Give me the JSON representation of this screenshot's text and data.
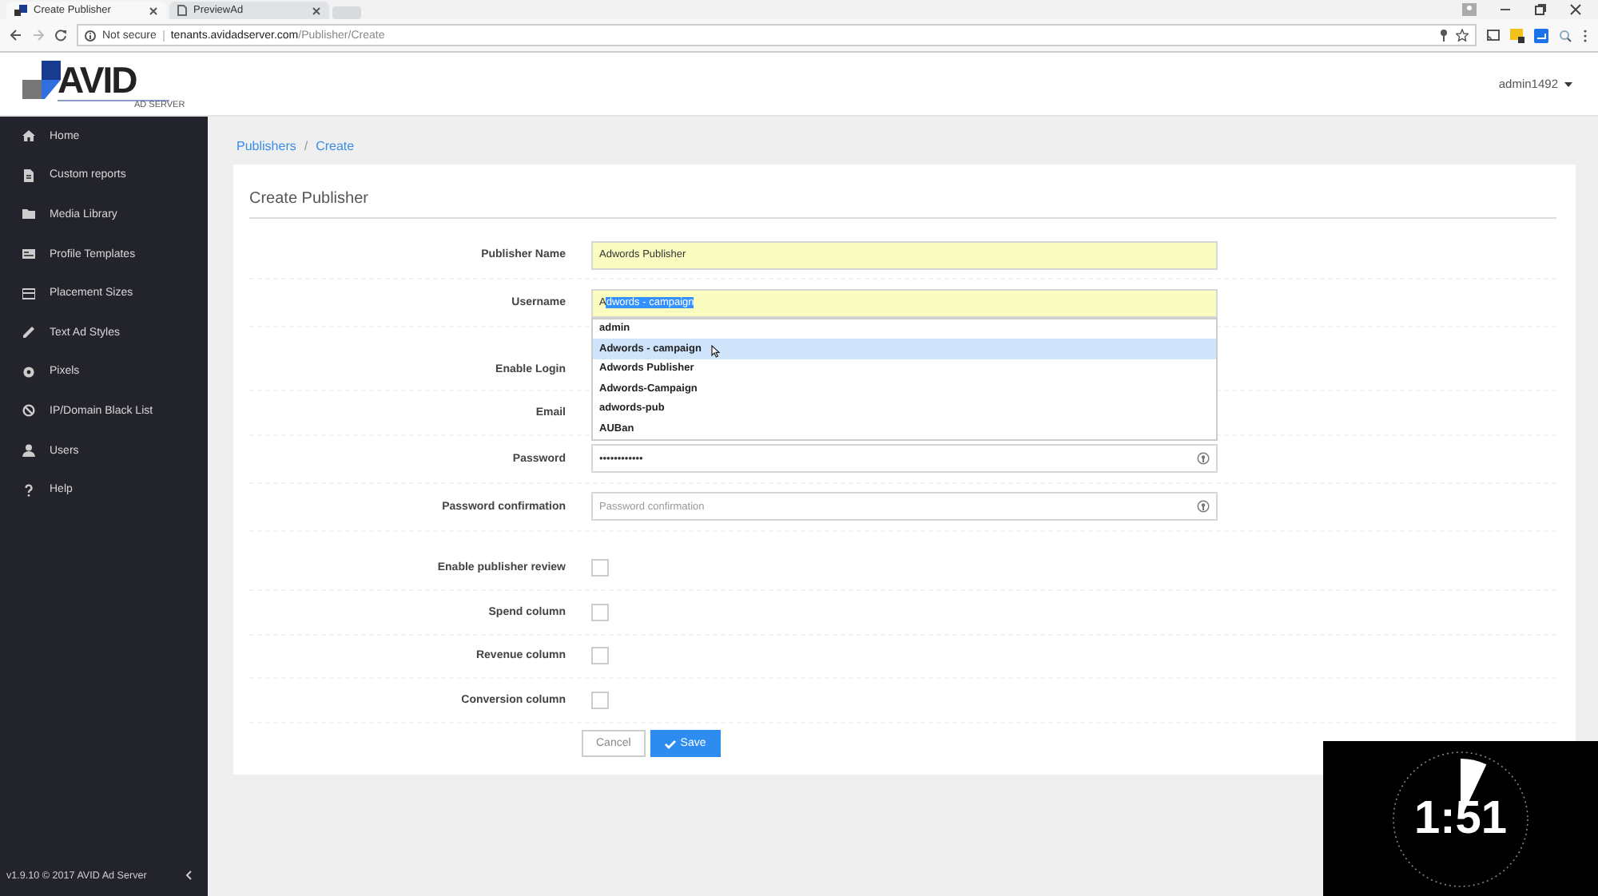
{
  "browser": {
    "tabs": [
      {
        "label": "Create Publisher",
        "selected": true
      },
      {
        "label": "PreviewAd",
        "selected": false
      }
    ],
    "security": "Not secure",
    "url_host": "tenants.avidadserver.com",
    "url_path": "/Publisher/Create"
  },
  "header": {
    "logo_text": "AVID",
    "logo_subtext": "AD SERVER",
    "user": "admin1492"
  },
  "sidebar": {
    "items": [
      {
        "label": "Home"
      },
      {
        "label": "Custom reports"
      },
      {
        "label": "Media Library"
      },
      {
        "label": "Profile Templates"
      },
      {
        "label": "Placement Sizes"
      },
      {
        "label": "Text Ad Styles"
      },
      {
        "label": "Pixels"
      },
      {
        "label": "IP/Domain Black List"
      },
      {
        "label": "Users"
      },
      {
        "label": "Help"
      }
    ],
    "footer": "v1.9.10 © 2017 AVID Ad Server"
  },
  "breadcrumb": {
    "items": [
      "Publishers",
      "Create"
    ],
    "separator": "/"
  },
  "form": {
    "title": "Create Publisher",
    "rows": [
      {
        "kind": "text",
        "label": "Publisher Name",
        "value": "Adwords Publisher"
      },
      {
        "kind": "autocomplete",
        "label": "Username",
        "typed": "A",
        "suggested": "dwords - campaign",
        "suggestions": [
          {
            "label": "admin",
            "selected": false
          },
          {
            "label": "Adwords - campaign",
            "selected": true
          },
          {
            "label": "Adwords Publisher",
            "selected": false
          },
          {
            "label": "Adwords-Campaign",
            "selected": false
          },
          {
            "label": "adwords-pub",
            "selected": false
          },
          {
            "label": "AUBan",
            "selected": false
          }
        ]
      },
      {
        "kind": "covered",
        "label": "Enable Login"
      },
      {
        "kind": "covered",
        "label": "Email"
      },
      {
        "kind": "password",
        "label": "Password",
        "value": "••••••••••••"
      },
      {
        "kind": "password",
        "label": "Password confirmation",
        "placeholder": "Password confirmation"
      },
      {
        "kind": "checkbox",
        "label": "Enable publisher review",
        "checked": false
      },
      {
        "kind": "checkbox",
        "label": "Spend column",
        "checked": false
      },
      {
        "kind": "checkbox",
        "label": "Revenue column",
        "checked": false
      },
      {
        "kind": "checkbox",
        "label": "Conversion column",
        "checked": false
      }
    ],
    "buttons": [
      {
        "kind": "cancel",
        "label": "Cancel"
      },
      {
        "kind": "save",
        "label": "Save"
      }
    ]
  },
  "timer": {
    "text": "1:51"
  }
}
